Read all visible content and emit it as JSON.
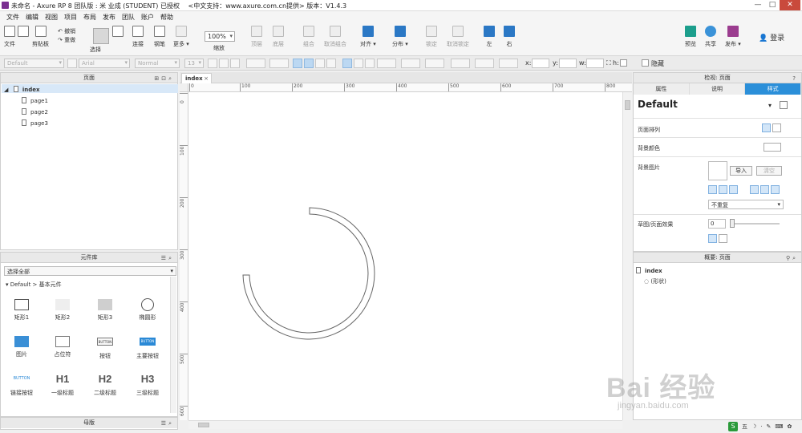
{
  "window": {
    "title": "未命名 - Axure RP 8 团队版 : 米 业成 (STUDENT) 已授权　 <中文支持：www.axure.com.cn提供> 版本：V1.4.3",
    "minimize": "—",
    "maximize": "□",
    "close": "✕"
  },
  "menu": [
    "文件",
    "编辑",
    "视图",
    "项目",
    "布局",
    "发布",
    "团队",
    "账户",
    "帮助"
  ],
  "toolbar": {
    "file": "文件",
    "clipboard": "剪贴板",
    "undo": "撤销",
    "redo": "重做",
    "select": "选择",
    "connect": "连接",
    "pen": "钢笔",
    "more": "更多 ▾",
    "zoom_value": "100%",
    "zoom_label": "缩放",
    "top_layer": "顶层",
    "bottom_layer": "底层",
    "group": "组合",
    "ungroup": "取消组合",
    "align": "对齐 ▾",
    "distribute": "分布 ▾",
    "lock": "锁定",
    "unlock": "取消锁定",
    "left": "左",
    "right": "右",
    "preview": "预览",
    "share": "共享",
    "publish": "发布 ▾",
    "login": "登录"
  },
  "format": {
    "style": "Default",
    "font": "Arial",
    "weight": "Normal",
    "size": "13",
    "x_label": "x:",
    "y_label": "y:",
    "w_label": "w:",
    "h_label": "h:",
    "hide_label": "隐藏"
  },
  "pages_panel": {
    "title": "页面",
    "root": "index",
    "children": [
      "page1",
      "page2",
      "page3"
    ]
  },
  "library_panel": {
    "title": "元件库",
    "filter": "选择全部",
    "group": "Default > 基本元件",
    "widgets": [
      {
        "label": "矩形1"
      },
      {
        "label": "矩形2"
      },
      {
        "label": "矩形3"
      },
      {
        "label": "椭圆形"
      },
      {
        "label": "图片"
      },
      {
        "label": "占位符"
      },
      {
        "label": "按钮",
        "text": "BUTTON"
      },
      {
        "label": "主要按钮",
        "text": "BUTTON"
      },
      {
        "label": "链接按钮",
        "text": "BUTTON"
      },
      {
        "label": "一级标题",
        "text": "H1"
      },
      {
        "label": "二级标题",
        "text": "H2"
      },
      {
        "label": "三级标题",
        "text": "H3"
      }
    ]
  },
  "masters_panel": {
    "title": "母版"
  },
  "canvas": {
    "tab": "index",
    "tab_close": "×",
    "ruler_h": [
      "0",
      "100",
      "200",
      "300",
      "400",
      "500",
      "600",
      "700",
      "800"
    ],
    "ruler_v": [
      "0",
      "100",
      "200",
      "300",
      "400",
      "500",
      "600"
    ]
  },
  "inspector": {
    "title": "检视: 页面",
    "tabs": [
      "属性",
      "说明",
      "样式"
    ],
    "active_tab": 2,
    "style_name": "Default",
    "page_align": "页面排列",
    "bg_color": "背景颜色",
    "bg_image": "背景图片",
    "import_btn": "导入",
    "clear_btn": "清空",
    "repeat": "不重复",
    "sketch_effect": "草图/页面效果",
    "sketch_value": "0"
  },
  "outline_panel": {
    "title": "概要: 页面",
    "root": "index",
    "child": "(形状)"
  },
  "tray": {
    "s": "S",
    "text": "五"
  },
  "watermark": {
    "brand": "Bai  经验",
    "url": "jingyan.baidu.com"
  }
}
